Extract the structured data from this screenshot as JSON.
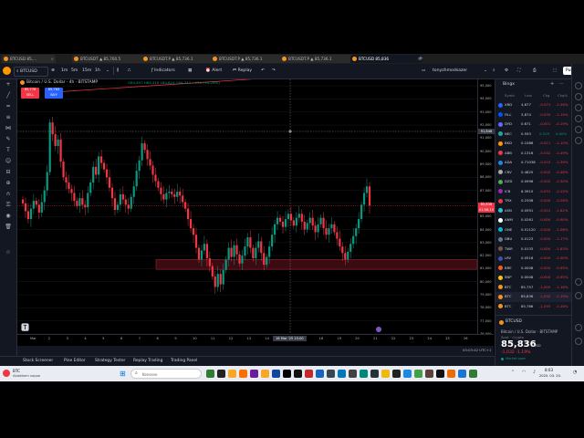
{
  "browser": {
    "tabs": [
      {
        "label": "BTCUSD 85,..."
      },
      {
        "label": "BTCUSDT ▲ 85,760.5"
      },
      {
        "label": "BTCUSDT.P ▲ 85,736.1"
      },
      {
        "label": "BTCUSDT.P ▲ 85,736.1"
      },
      {
        "label": "BTCUSDT ▲ 85,736.1"
      },
      {
        "label": "BTCUSDT.P ▲ 85,736.1"
      },
      {
        "label": "BTCUSD 85,836"
      }
    ]
  },
  "toolbar": {
    "symbol": "BTCUSD",
    "intervals": [
      "1m",
      "5m",
      "15m",
      "1h"
    ],
    "indicators": "Indicators",
    "alert": "Alert",
    "replay": "Replay",
    "user": "tonyzhmodsazer",
    "publish": "Publish"
  },
  "chart": {
    "legend_title": "Bitcoin / U.S. Dollar · 4h · BITSTAMP",
    "ohlc": "O84,857 H85,418 L84,624 C84,744 +235 (+0.28%)",
    "sell_price": "85,778",
    "sell_label": "SELL",
    "buy_price": "85,783",
    "buy_label": "BUY",
    "crosshair_price": "91,846",
    "last_price": "85,836",
    "last_time": "01:56:10",
    "date_cursor": "16 Mar '25 15:00",
    "bottom_time": "03:03:42 UTC+1",
    "price_ticks": [
      "95,000",
      "94,000",
      "93,000",
      "92,000",
      "91,000",
      "90,000",
      "89,000",
      "88,000",
      "87,000",
      "86,000",
      "85,000",
      "84,000",
      "83,000",
      "82,000",
      "81,000",
      "80,000",
      "79,000",
      "78,000",
      "77,000",
      "76,000"
    ],
    "time_ticks": [
      "Mar",
      "2",
      "3",
      "4",
      "5",
      "6",
      "7",
      "8",
      "9",
      "10",
      "11",
      "12",
      "13",
      "14",
      "15",
      "17",
      "18",
      "19",
      "20",
      "21",
      "22",
      "23",
      "24",
      "25",
      "26"
    ]
  },
  "bottom_tabs": [
    "Stock Screener",
    "Pine Editor",
    "Strategy Tester",
    "Replay Trading",
    "Trading Panel"
  ],
  "watchlist": {
    "title": "Bingx",
    "columns": [
      "Symb",
      "Last",
      "Chg",
      "Chg%"
    ],
    "rows": [
      {
        "sym": "XRD",
        "last": "4,677",
        "chg": "-0.071",
        "pct": "-1.56%",
        "color": "#2962ff",
        "dir": "red"
      },
      {
        "sym": "FILL",
        "last": "3,874",
        "chg": "-0.035",
        "pct": "-1.19%",
        "color": "#0052ff",
        "dir": "red"
      },
      {
        "sym": "DYD",
        "last": "0.671",
        "chg": "-0.001",
        "pct": "-0.19%",
        "color": "#6966ff",
        "dir": "red"
      },
      {
        "sym": "NEC",
        "last": "0.593",
        "chg": "0.015",
        "pct": "0.00%",
        "color": "#26a69a",
        "dir": "green"
      },
      {
        "sym": "BKD",
        "last": "0.1086",
        "chg": "-0.011",
        "pct": "-1.10%",
        "color": "#ff9800",
        "dir": "red"
      },
      {
        "sym": "ABB",
        "last": "0.1316",
        "chg": "-0.032",
        "pct": "-1.49%",
        "color": "#f23645",
        "dir": "red"
      },
      {
        "sym": "ADA",
        "last": "0.71038",
        "chg": "-0.010",
        "pct": "-1.39%",
        "color": "#1e88e5",
        "dir": "red"
      },
      {
        "sym": "CRV",
        "last": "0.4825",
        "chg": "-0.002",
        "pct": "-0.48%",
        "color": "#aaaaaa",
        "dir": "red"
      },
      {
        "sym": "DZD",
        "last": "0.0996",
        "chg": "-0.002",
        "pct": "-2.30%",
        "color": "#4caf50",
        "dir": "red"
      },
      {
        "sym": "ICB",
        "last": "6.3915",
        "chg": "-0.031",
        "pct": "-0.15%",
        "color": "#9c27b0",
        "dir": "red"
      },
      {
        "sym": "TRX",
        "last": "0.2308",
        "chg": "-0.000",
        "pct": "-0.26%",
        "color": "#f23645",
        "dir": "red"
      },
      {
        "sym": "ASN",
        "last": "0.0591",
        "chg": "-0.001",
        "pct": "-1.82%",
        "color": "#26c6da",
        "dir": "red"
      },
      {
        "sym": "ANM",
        "last": "0.0261",
        "chg": "-0.000",
        "pct": "-0.90%",
        "color": "#ffffff",
        "dir": "red"
      },
      {
        "sym": "ONE",
        "last": "0.01120",
        "chg": "-0.000",
        "pct": "-1.06%",
        "color": "#00bcd4",
        "dir": "red"
      },
      {
        "sym": "DBU",
        "last": "0.0123",
        "chg": "-0.000",
        "pct": "-1.17%",
        "color": "#607d8b",
        "dir": "red"
      },
      {
        "sym": "TWR",
        "last": "0.0133",
        "chg": "-0.000",
        "pct": "-1.83%",
        "color": "#795548",
        "dir": "red"
      },
      {
        "sym": "LRV",
        "last": "0.0516",
        "chg": "-0.000",
        "pct": "-1.00%",
        "color": "#3f51b5",
        "dir": "red"
      },
      {
        "sym": "BRE",
        "last": "0.0008",
        "chg": "-0.000",
        "pct": "-0.95%",
        "color": "#ff5722",
        "dir": "red"
      },
      {
        "sym": "SNP",
        "last": "0.0008",
        "chg": "-0.000",
        "pct": "-0.95%",
        "color": "#ffc107",
        "dir": "red"
      },
      {
        "sym": "BTC",
        "last": "85,757",
        "chg": "-1,005",
        "pct": "-1.16%",
        "color": "#f7931a",
        "dir": "red"
      },
      {
        "sym": "BTC",
        "last": "85,836",
        "chg": "-1,032",
        "pct": "-1.19%",
        "color": "#f7931a",
        "dir": "red"
      },
      {
        "sym": "BTC",
        "last": "85,766",
        "chg": "-1,093",
        "pct": "-1.26%",
        "color": "#f7931a",
        "dir": "red"
      }
    ],
    "detail": {
      "symbol": "BTCUSD",
      "price": "85,836",
      "currency": "USD",
      "change": "-1,032 -1.19%",
      "name": "Bitcoin / U.S. Dollar · BITSTAMP",
      "type": "Spot · Crypto",
      "status": "Market open"
    }
  },
  "taskbar": {
    "weather_title": "BTC",
    "weather_sub": "Abiekkem napoe",
    "search_placeholder": "Kenesse",
    "time": "8:03",
    "date": "2025. 03. 20."
  },
  "colors": {
    "up": "#089981",
    "down": "#f23645",
    "zone": "#6b1420"
  },
  "chart_data": {
    "type": "candlestick",
    "ylim": [
      76000,
      95500
    ],
    "zone": {
      "low": 80950,
      "high": 81700
    },
    "candles_close": [
      86000,
      85400,
      84800,
      85600,
      86200,
      85900,
      85300,
      86100,
      87000,
      88400,
      92200,
      91300,
      90400,
      90900,
      89200,
      88000,
      87600,
      87100,
      86800,
      86200,
      85800,
      86400,
      85900,
      85700,
      86800,
      87600,
      88800,
      88200,
      89600,
      89100,
      88600,
      88000,
      87200,
      86400,
      85500,
      85900,
      86700,
      86300,
      85900,
      85600,
      86500,
      87300,
      88500,
      89300,
      90600,
      90100,
      89400,
      88900,
      88200,
      87700,
      87200,
      86700,
      86300,
      86800,
      86900,
      86700,
      86500,
      86900,
      86600,
      86100,
      85600,
      84800,
      84100,
      83600,
      82600,
      81700,
      82400,
      82900,
      81800,
      81200,
      80400,
      79600,
      80600,
      79800,
      80900,
      81700,
      82600,
      81900,
      82800,
      82100,
      81400,
      82000,
      82700,
      83400,
      82600,
      81800,
      82600,
      83100,
      82200,
      81300,
      81900,
      82700,
      83600,
      84400,
      84900,
      84600,
      84200,
      84800,
      85200,
      84700,
      84300,
      84900,
      85200,
      84600,
      84000,
      84500,
      84900,
      84300,
      83800,
      84400,
      84900,
      84100,
      83600,
      84100,
      84400,
      83800,
      83300,
      82700,
      82200,
      81700,
      82300,
      82900,
      83500,
      84100,
      84800,
      85900,
      86800,
      87300,
      85836
    ],
    "x_range": [
      "Mar",
      "26"
    ]
  }
}
